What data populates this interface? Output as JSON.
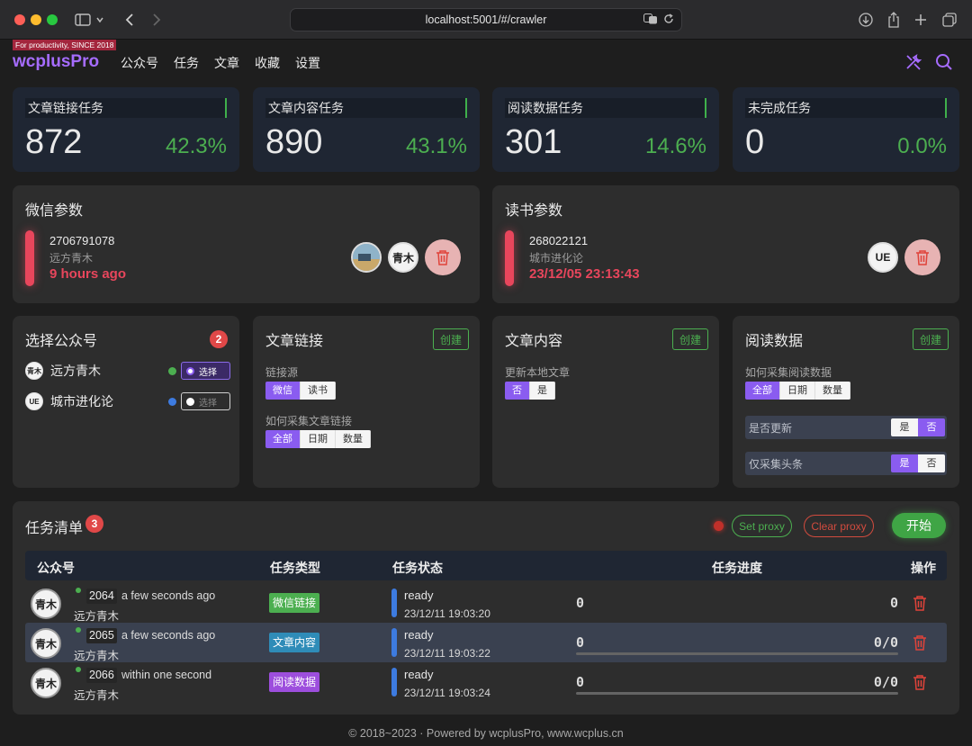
{
  "browser": {
    "url": "localhost:5001/#/crawler"
  },
  "header": {
    "tagline": "For productivity, SINCE 2018",
    "brand": "wcplusPro",
    "nav": [
      "公众号",
      "任务",
      "文章",
      "收藏",
      "设置"
    ]
  },
  "stats": [
    {
      "title": "文章链接任务",
      "count": "872",
      "percent": "42.3%"
    },
    {
      "title": "文章内容任务",
      "count": "890",
      "percent": "43.1%"
    },
    {
      "title": "阅读数据任务",
      "count": "301",
      "percent": "14.6%"
    },
    {
      "title": "未完成任务",
      "count": "0",
      "percent": "0.0%"
    }
  ],
  "wechat_params": {
    "title": "微信参数",
    "id": "2706791078",
    "name": "远方青木",
    "time": "9 hours ago",
    "avatar_labels": [
      "青木"
    ]
  },
  "weread_params": {
    "title": "读书参数",
    "id": "268022121",
    "name": "城市进化论",
    "time": "23/12/05 23:13:43",
    "avatar_label": "UE"
  },
  "select_account": {
    "title": "选择公众号",
    "badge": "2",
    "accounts": [
      {
        "avatar": "青木",
        "name": "远方青木",
        "dot_color": "#4caf50",
        "toggle_label": "选择",
        "selected": true
      },
      {
        "avatar": "UE",
        "name": "城市进化论",
        "dot_color": "#3d7be0",
        "toggle_label": "选择",
        "selected": false
      }
    ]
  },
  "article_links": {
    "title": "文章链接",
    "create": "创建",
    "source_label": "链接源",
    "source_options": [
      "微信",
      "读书"
    ],
    "method_label": "如何采集文章链接",
    "method_options": [
      "全部",
      "日期",
      "数量"
    ]
  },
  "article_content": {
    "title": "文章内容",
    "create": "创建",
    "update_label": "更新本地文章",
    "update_options": [
      "否",
      "是"
    ]
  },
  "read_data": {
    "title": "阅读数据",
    "create": "创建",
    "method_label": "如何采集阅读数据",
    "method_options": [
      "全部",
      "日期",
      "数量"
    ],
    "update_label": "是否更新",
    "update_options": [
      "是",
      "否"
    ],
    "headline_label": "仅采集头条",
    "headline_options": [
      "是",
      "否"
    ]
  },
  "task_list": {
    "title": "任务清单",
    "badge": "3",
    "set_proxy": "Set proxy",
    "clear_proxy": "Clear proxy",
    "start": "开始",
    "columns": {
      "account": "公众号",
      "type": "任务类型",
      "status": "任务状态",
      "progress": "任务进度",
      "actions": "操作"
    },
    "rows": [
      {
        "avatar": "青木",
        "id": "2064",
        "when": "a few seconds ago",
        "name": "远方青木",
        "type": "微信链接",
        "type_color": "#4caf50",
        "status": "ready",
        "time": "23/12/11 19:03:20",
        "done": "0",
        "total": "0",
        "show_bar": false
      },
      {
        "avatar": "青木",
        "id": "2065",
        "when": "a few seconds ago",
        "name": "远方青木",
        "type": "文章内容",
        "type_color": "#2f8cb8",
        "status": "ready",
        "time": "23/12/11 19:03:22",
        "done": "0",
        "total": "0/0",
        "show_bar": true
      },
      {
        "avatar": "青木",
        "id": "2066",
        "when": "within one second",
        "name": "远方青木",
        "type": "阅读数据",
        "type_color": "#9d4edd",
        "status": "ready",
        "time": "23/12/11 19:03:24",
        "done": "0",
        "total": "0/0",
        "show_bar": true
      }
    ]
  },
  "footer": "© 2018~2023 · Powered by wcplusPro, www.wcplus.cn"
}
